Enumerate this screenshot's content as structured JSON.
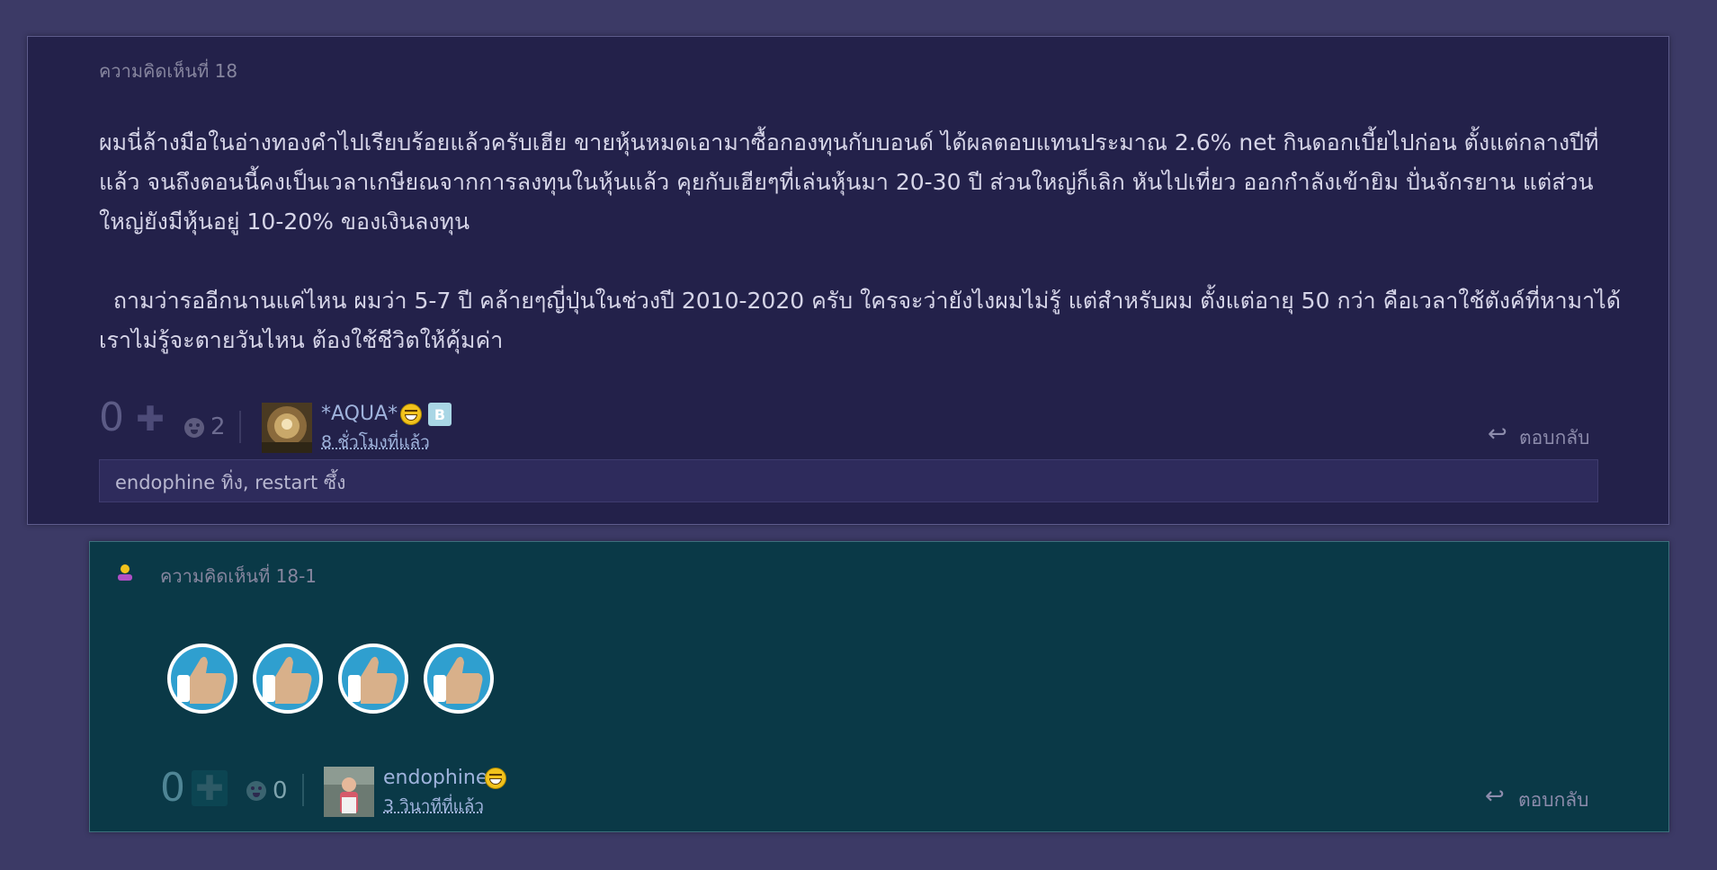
{
  "comment_18": {
    "label": "ความคิดเห็นที่ 18",
    "paragraphs": [
      "ผมนี่ล้างมือในอ่างทองคำไปเรียบร้อยแล้วครับเฮีย ขายหุ้นหมดเอามาซื้อกองทุนกับบอนด์ ได้ผลตอบแทนประมาณ 2.6% net กินดอกเบี้ยไปก่อน ตั้งแต่กลางปีที่แล้ว จนถึงตอนนี้คงเป็นเวลาเกษียณจากการลงทุนในหุ้นแล้ว คุยกับเฮียๆที่เล่นหุ้นมา 20-30 ปี ส่วนใหญ่ก็เลิก หันไปเที่ยว ออกกำลังเข้ายิม ปั่นจักรยาน แต่ส่วนใหญ่ยังมีหุ้นอยู่ 10-20% ของเงินลงทุน",
      "  ถามว่ารออีกนานแค่ไหน ผมว่า 5-7 ปี คล้ายๆญี่ปุ่นในช่วงปี 2010-2020 ครับ ใครจะว่ายังไงผมไม่รู้ แต่สำหรับผม ตั้งแต่อายุ 50 กว่า คือเวลาใช้ตังค์ที่หามาได้ เราไม่รู้จะตายวันไหน ต้องใช้ชีวิตให้คุ้มค่า"
    ],
    "score": "0",
    "reaction_count": "2",
    "username": "*AQUA*",
    "badge": "B",
    "time": "8 ชั่วโมงที่แล้ว",
    "reply_label": "ตอบกลับ",
    "reply_box_text": "endophine ทิ่ง, restart ซึ้ง"
  },
  "comment_18_1": {
    "label": "ความคิดเห็นที่ 18-1",
    "score": "0",
    "reaction_count": "0",
    "username": "endophine",
    "time": "3 วินาทีที่แล้ว",
    "reply_label": "ตอบกลับ"
  },
  "icons": {
    "plus": "plus-icon",
    "reaction": "emotion-icon",
    "reply": "reply-arrow-icon",
    "smiley": "grin-emoticon",
    "thumbs": "thumbs-up-sticker",
    "user_role": "user-role-icon"
  },
  "colors": {
    "background": "#3c3a66",
    "comment_bg": "#23214a",
    "reply_comment_bg": "#0a3947",
    "username": "#9fb3dc"
  }
}
